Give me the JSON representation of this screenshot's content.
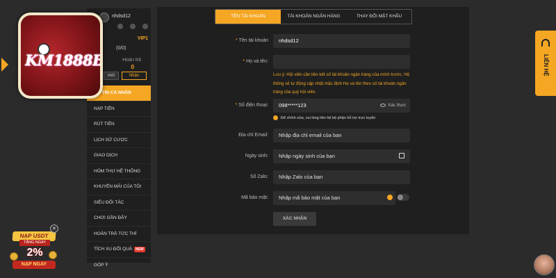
{
  "brand": {
    "logo_text": "KM1888B"
  },
  "sidebar": {
    "username": "nhdsd12",
    "vip": "VIP1",
    "stat_value": "(0/0)",
    "stat_label": "Hoàn trả",
    "stat_amount": "0",
    "btn_moi": "mời",
    "btn_nhan": "Nhận",
    "menu": [
      {
        "label": "NG TIN CÁ NHÂN",
        "active": true
      },
      {
        "label": "NẠP TIỀN"
      },
      {
        "label": "RÚT TIỀN"
      },
      {
        "label": "LỊCH SỬ CƯỢC"
      },
      {
        "label": "GIAO DỊCH"
      },
      {
        "label": "HÒM THƯ HỆ THỐNG"
      },
      {
        "label": "KHUYẾN MÃI CỦA TÔI"
      },
      {
        "label": "SIÊU ĐỐI TÁC"
      },
      {
        "label": "CHƠI GẦN ĐÂY"
      },
      {
        "label": "HOÀN TRẢ TỨC THÌ"
      },
      {
        "label": "TÍCH XU ĐỔI QUÀ",
        "badge": "NEW"
      },
      {
        "label": "GÓP Ý"
      }
    ]
  },
  "tabs": [
    "TÊN TÀI KHOẢN",
    "TÀI KHOẢN NGÂN HÀNG",
    "THAY ĐỔI MẬT KHẨU"
  ],
  "form": {
    "account_label": "Tên tài khoản",
    "account_value": "nhdsd12",
    "fullname_label": "Họ và tên:",
    "fullname_value": "",
    "note": "Lưu ý: Hội viên cần liên kết số tài khoản ngân hàng của mình trước. Hệ thống sẽ tự động cập nhật mặc định Họ và tên theo số tài khoản ngân hàng của quý hội viên.",
    "phone_label": "Số điện thoại:",
    "phone_value": "098*****123",
    "phone_action": "Xác thực",
    "phone_hint": "Để chỉnh sửa, vui lòng liên hệ bộ phận hỗ trợ trực tuyến",
    "email_label": "Địa chỉ Email:",
    "email_placeholder": "Nhập địa chỉ email của bạn",
    "birthday_label": "Ngày sinh:",
    "birthday_placeholder": "Nhập ngày sinh của bạn",
    "zalo_label": "Số Zalo:",
    "zalo_placeholder": "Nhập Zalo của bạn",
    "security_label": "Mã bảo mật:",
    "security_placeholder": "Nhập mã bảo mật của bạn",
    "confirm": "XÁC NHẬN"
  },
  "contact": {
    "label": "LIÊN HỆ"
  },
  "promo": {
    "title": "NẠP USDT",
    "sub": "TẶNG NGAY",
    "percent": "2%",
    "cta": "NẠP NGAY",
    "close": "×"
  },
  "colors": {
    "accent": "#f5a623",
    "background": "#2b2b2b",
    "panel": "#1f1f1f"
  }
}
